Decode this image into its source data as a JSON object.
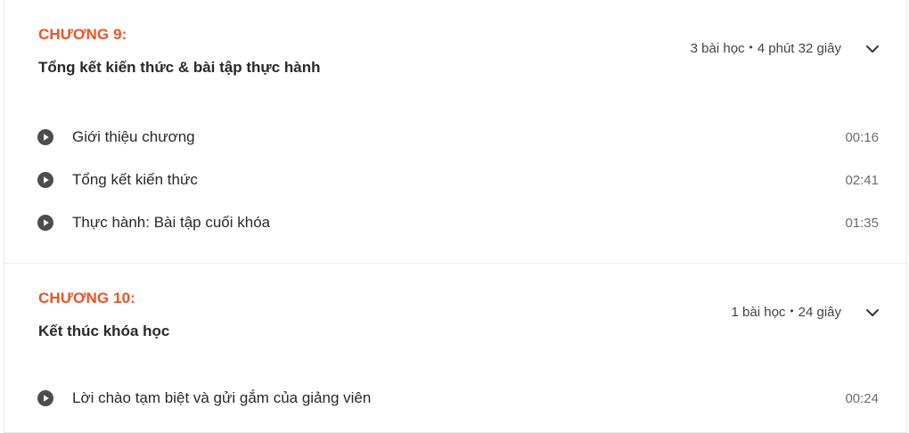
{
  "chapters": [
    {
      "number": "CHƯƠNG 9:",
      "title": "Tổng kết kiến thức & bài tập thực hành",
      "lesson_count": "3 bài học",
      "separator": "•",
      "duration": "4 phút 32 giây",
      "expand_icon": "chevron-down-icon",
      "lessons": [
        {
          "title": "Giới thiệu chương",
          "time": "00:16",
          "icon": "play-circle-icon"
        },
        {
          "title": "Tổng kết kiến thức",
          "time": "02:41",
          "icon": "play-circle-icon"
        },
        {
          "title": "Thực hành: Bài tập cuối khóa",
          "time": "01:35",
          "icon": "play-circle-icon"
        }
      ]
    },
    {
      "number": "CHƯƠNG 10:",
      "title": "Kết thúc khóa học",
      "lesson_count": "1 bài học",
      "separator": "•",
      "duration": "24 giây",
      "expand_icon": "chevron-down-icon",
      "lessons": [
        {
          "title": "Lời chào tạm biệt và gửi gắm của giảng viên",
          "time": "00:24",
          "icon": "play-circle-icon"
        }
      ]
    }
  ],
  "colors": {
    "accent": "#f05123",
    "text": "#292929",
    "muted": "#6c6c6c",
    "icon": "#4d4d4d"
  }
}
